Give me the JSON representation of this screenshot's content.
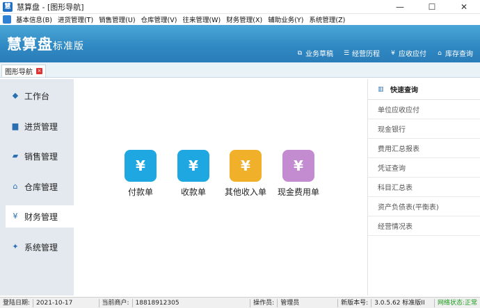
{
  "window": {
    "app_icon_text": "慧",
    "title": "慧算盘 - [图形导航]",
    "min_glyph": "—",
    "max_glyph": "☐",
    "close_glyph": "✕"
  },
  "menu": {
    "items": [
      "基本信息(B)",
      "进货管理(T)",
      "销售管理(U)",
      "仓库管理(V)",
      "往来管理(W)",
      "财务管理(X)",
      "辅助业务(Y)",
      "系统管理(Z)"
    ]
  },
  "banner": {
    "brand": "慧算盘",
    "edition": "标准版",
    "nav": [
      {
        "label": "业务草稿",
        "icon": "external-icon"
      },
      {
        "label": "经营历程",
        "icon": "list-icon"
      },
      {
        "label": "应收应付",
        "icon": "yen-icon"
      },
      {
        "label": "库存查询",
        "icon": "home-icon"
      }
    ]
  },
  "tab": {
    "label": "图形导航",
    "close": "×"
  },
  "leftnav": {
    "active": "财务管理",
    "items": [
      {
        "label": "工作台",
        "icon": "layers-icon",
        "glyph": "◆"
      },
      {
        "label": "进货管理",
        "icon": "cart-icon",
        "glyph": "▆"
      },
      {
        "label": "销售管理",
        "icon": "truck-icon",
        "glyph": "▰"
      },
      {
        "label": "仓库管理",
        "icon": "warehouse-icon",
        "glyph": "⌂"
      },
      {
        "label": "财务管理",
        "icon": "yen-icon",
        "glyph": "¥"
      },
      {
        "label": "系统管理",
        "icon": "wrench-icon",
        "glyph": "✦"
      }
    ]
  },
  "tiles": [
    {
      "label": "付款单",
      "icon": "payment-icon",
      "glyph": "¥",
      "color": "#1ea7e1"
    },
    {
      "label": "收款单",
      "icon": "receipt-icon",
      "glyph": "¥",
      "color": "#1ea7e1"
    },
    {
      "label": "其他收入单",
      "icon": "income-icon",
      "glyph": "¥",
      "color": "#f0b02a"
    },
    {
      "label": "现金费用单",
      "icon": "cash-expense-icon",
      "glyph": "¥",
      "color": "#c38bd0"
    }
  ],
  "quick": {
    "title": "快速查询",
    "items": [
      "单位应收应付",
      "现金银行",
      "费用汇总报表",
      "凭证查询",
      "科目汇总表",
      "资产负债表(平衡表)",
      "经营情况表"
    ]
  },
  "status": {
    "login_date_label": "登陆日期:",
    "login_date": "2021-10-17",
    "merchant_label": "当前商户:",
    "merchant": "18818912305",
    "operator_label": "操作员:",
    "operator": "管理员",
    "version_label": "新版本号:",
    "version": "3.0.5.62 标准版II",
    "network": "网络状态:正常"
  }
}
